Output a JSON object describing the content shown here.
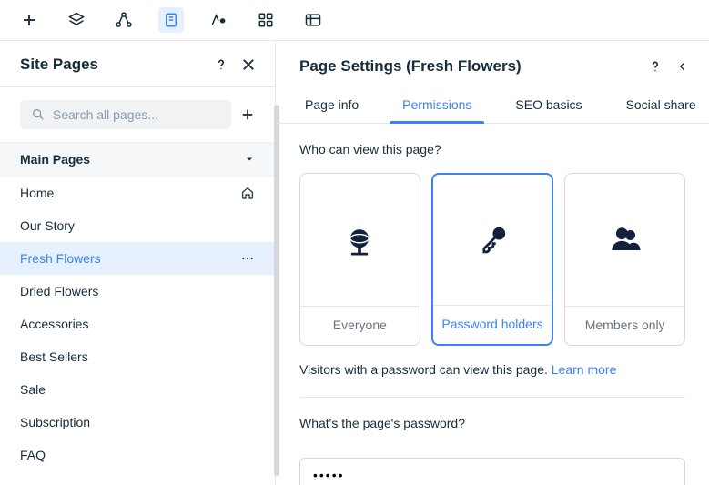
{
  "toolbar": {
    "items": [
      "add",
      "layers",
      "structure",
      "page",
      "design",
      "apps",
      "data"
    ],
    "active_index": 3
  },
  "left": {
    "title": "Site Pages",
    "search_placeholder": "Search all pages...",
    "section_title": "Main Pages",
    "pages": [
      {
        "label": "Home",
        "icon": "home"
      },
      {
        "label": "Our Story"
      },
      {
        "label": "Fresh Flowers",
        "selected": true,
        "actions": true
      },
      {
        "label": "Dried Flowers"
      },
      {
        "label": "Accessories"
      },
      {
        "label": "Best Sellers"
      },
      {
        "label": "Sale"
      },
      {
        "label": "Subscription"
      },
      {
        "label": "FAQ"
      }
    ]
  },
  "right": {
    "title": "Page Settings (Fresh Flowers)",
    "tabs": [
      {
        "label": "Page info"
      },
      {
        "label": "Permissions",
        "active": true
      },
      {
        "label": "SEO basics"
      },
      {
        "label": "Social share"
      }
    ],
    "permissions": {
      "question": "Who can view this page?",
      "options": [
        {
          "label": "Everyone",
          "icon": "globe"
        },
        {
          "label": "Password holders",
          "icon": "key",
          "selected": true
        },
        {
          "label": "Members only",
          "icon": "members"
        }
      ],
      "hint_text": "Visitors with a password can view this page. ",
      "hint_link": "Learn more",
      "password_label": "What's the page's password?",
      "password_value": "•••••"
    }
  }
}
